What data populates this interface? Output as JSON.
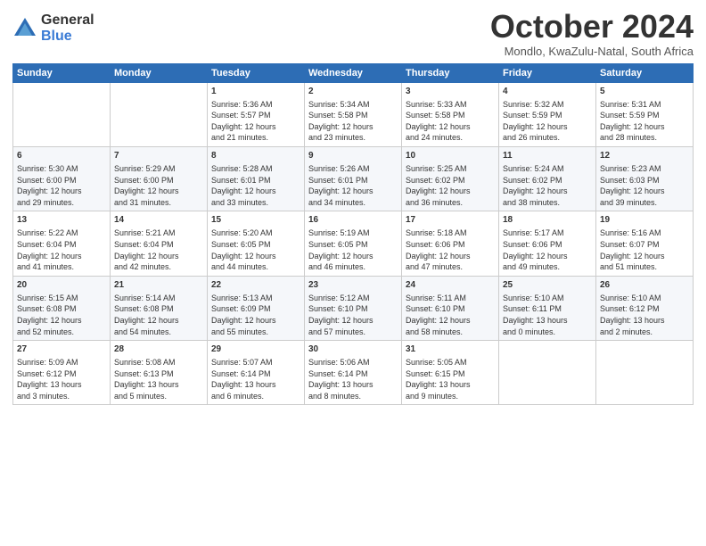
{
  "logo": {
    "general": "General",
    "blue": "Blue"
  },
  "title": "October 2024",
  "subtitle": "Mondlo, KwaZulu-Natal, South Africa",
  "days_of_week": [
    "Sunday",
    "Monday",
    "Tuesday",
    "Wednesday",
    "Thursday",
    "Friday",
    "Saturday"
  ],
  "weeks": [
    [
      {
        "day": "",
        "info": ""
      },
      {
        "day": "",
        "info": ""
      },
      {
        "day": "1",
        "info": "Sunrise: 5:36 AM\nSunset: 5:57 PM\nDaylight: 12 hours\nand 21 minutes."
      },
      {
        "day": "2",
        "info": "Sunrise: 5:34 AM\nSunset: 5:58 PM\nDaylight: 12 hours\nand 23 minutes."
      },
      {
        "day": "3",
        "info": "Sunrise: 5:33 AM\nSunset: 5:58 PM\nDaylight: 12 hours\nand 24 minutes."
      },
      {
        "day": "4",
        "info": "Sunrise: 5:32 AM\nSunset: 5:59 PM\nDaylight: 12 hours\nand 26 minutes."
      },
      {
        "day": "5",
        "info": "Sunrise: 5:31 AM\nSunset: 5:59 PM\nDaylight: 12 hours\nand 28 minutes."
      }
    ],
    [
      {
        "day": "6",
        "info": "Sunrise: 5:30 AM\nSunset: 6:00 PM\nDaylight: 12 hours\nand 29 minutes."
      },
      {
        "day": "7",
        "info": "Sunrise: 5:29 AM\nSunset: 6:00 PM\nDaylight: 12 hours\nand 31 minutes."
      },
      {
        "day": "8",
        "info": "Sunrise: 5:28 AM\nSunset: 6:01 PM\nDaylight: 12 hours\nand 33 minutes."
      },
      {
        "day": "9",
        "info": "Sunrise: 5:26 AM\nSunset: 6:01 PM\nDaylight: 12 hours\nand 34 minutes."
      },
      {
        "day": "10",
        "info": "Sunrise: 5:25 AM\nSunset: 6:02 PM\nDaylight: 12 hours\nand 36 minutes."
      },
      {
        "day": "11",
        "info": "Sunrise: 5:24 AM\nSunset: 6:02 PM\nDaylight: 12 hours\nand 38 minutes."
      },
      {
        "day": "12",
        "info": "Sunrise: 5:23 AM\nSunset: 6:03 PM\nDaylight: 12 hours\nand 39 minutes."
      }
    ],
    [
      {
        "day": "13",
        "info": "Sunrise: 5:22 AM\nSunset: 6:04 PM\nDaylight: 12 hours\nand 41 minutes."
      },
      {
        "day": "14",
        "info": "Sunrise: 5:21 AM\nSunset: 6:04 PM\nDaylight: 12 hours\nand 42 minutes."
      },
      {
        "day": "15",
        "info": "Sunrise: 5:20 AM\nSunset: 6:05 PM\nDaylight: 12 hours\nand 44 minutes."
      },
      {
        "day": "16",
        "info": "Sunrise: 5:19 AM\nSunset: 6:05 PM\nDaylight: 12 hours\nand 46 minutes."
      },
      {
        "day": "17",
        "info": "Sunrise: 5:18 AM\nSunset: 6:06 PM\nDaylight: 12 hours\nand 47 minutes."
      },
      {
        "day": "18",
        "info": "Sunrise: 5:17 AM\nSunset: 6:06 PM\nDaylight: 12 hours\nand 49 minutes."
      },
      {
        "day": "19",
        "info": "Sunrise: 5:16 AM\nSunset: 6:07 PM\nDaylight: 12 hours\nand 51 minutes."
      }
    ],
    [
      {
        "day": "20",
        "info": "Sunrise: 5:15 AM\nSunset: 6:08 PM\nDaylight: 12 hours\nand 52 minutes."
      },
      {
        "day": "21",
        "info": "Sunrise: 5:14 AM\nSunset: 6:08 PM\nDaylight: 12 hours\nand 54 minutes."
      },
      {
        "day": "22",
        "info": "Sunrise: 5:13 AM\nSunset: 6:09 PM\nDaylight: 12 hours\nand 55 minutes."
      },
      {
        "day": "23",
        "info": "Sunrise: 5:12 AM\nSunset: 6:10 PM\nDaylight: 12 hours\nand 57 minutes."
      },
      {
        "day": "24",
        "info": "Sunrise: 5:11 AM\nSunset: 6:10 PM\nDaylight: 12 hours\nand 58 minutes."
      },
      {
        "day": "25",
        "info": "Sunrise: 5:10 AM\nSunset: 6:11 PM\nDaylight: 13 hours\nand 0 minutes."
      },
      {
        "day": "26",
        "info": "Sunrise: 5:10 AM\nSunset: 6:12 PM\nDaylight: 13 hours\nand 2 minutes."
      }
    ],
    [
      {
        "day": "27",
        "info": "Sunrise: 5:09 AM\nSunset: 6:12 PM\nDaylight: 13 hours\nand 3 minutes."
      },
      {
        "day": "28",
        "info": "Sunrise: 5:08 AM\nSunset: 6:13 PM\nDaylight: 13 hours\nand 5 minutes."
      },
      {
        "day": "29",
        "info": "Sunrise: 5:07 AM\nSunset: 6:14 PM\nDaylight: 13 hours\nand 6 minutes."
      },
      {
        "day": "30",
        "info": "Sunrise: 5:06 AM\nSunset: 6:14 PM\nDaylight: 13 hours\nand 8 minutes."
      },
      {
        "day": "31",
        "info": "Sunrise: 5:05 AM\nSunset: 6:15 PM\nDaylight: 13 hours\nand 9 minutes."
      },
      {
        "day": "",
        "info": ""
      },
      {
        "day": "",
        "info": ""
      }
    ]
  ]
}
